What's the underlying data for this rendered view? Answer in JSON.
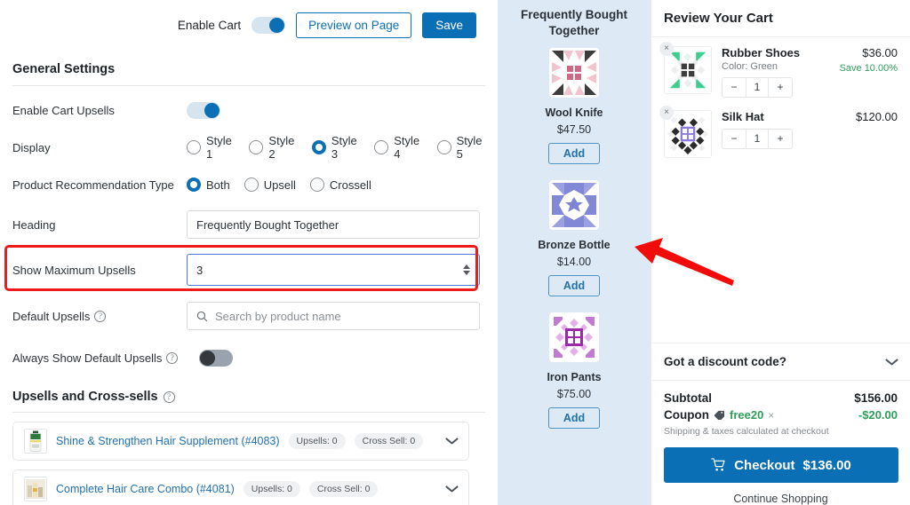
{
  "settings": {
    "topbar": {
      "enable_cart_label": "Enable Cart",
      "enable_cart_state": "on",
      "preview_label": "Preview on Page",
      "save_label": "Save"
    },
    "section_title": "General Settings",
    "enable_upsells": {
      "label": "Enable Cart Upsells",
      "state": "on"
    },
    "display": {
      "label": "Display",
      "options": [
        "Style 1",
        "Style 2",
        "Style 3",
        "Style 4",
        "Style 5"
      ],
      "selected": "Style 3"
    },
    "recommendation_type": {
      "label": "Product Recommendation Type",
      "options": [
        "Both",
        "Upsell",
        "Crossell"
      ],
      "selected": "Both"
    },
    "heading": {
      "label": "Heading",
      "value": "Frequently Bought Together"
    },
    "max_upsells": {
      "label": "Show Maximum Upsells",
      "value": "3",
      "highlighted": true
    },
    "default_upsells": {
      "label": "Default Upsells",
      "help": "?",
      "placeholder": "Search by product name",
      "value": ""
    },
    "always_show_default": {
      "label": "Always Show Default Upsells",
      "help": "?",
      "state": "off"
    },
    "upsells_cross_sells": {
      "title": "Upsells and Cross-sells",
      "help": "?",
      "products": [
        {
          "name": "Shine & Strengthen Hair Supplement (#4083)",
          "upsells_badge": "Upsells: 0",
          "crosssell_badge": "Cross Sell: 0"
        },
        {
          "name": "Complete Hair Care Combo (#4081)",
          "upsells_badge": "Upsells: 0",
          "crosssell_badge": "Cross Sell: 0"
        }
      ]
    }
  },
  "fbt": {
    "title": "Frequently Bought\nTogether",
    "title_line1": "Frequently Bought",
    "title_line2": "Together",
    "items": [
      {
        "name": "Wool Knife",
        "price": "$47.50",
        "add_label": "Add",
        "swatch": "#d9788f"
      },
      {
        "name": "Bronze Bottle",
        "price": "$14.00",
        "add_label": "Add",
        "swatch": "#7b7fd0"
      },
      {
        "name": "Iron Pants",
        "price": "$75.00",
        "add_label": "Add",
        "swatch": "#9b29a8"
      }
    ]
  },
  "cart": {
    "title": "Review Your Cart",
    "items": [
      {
        "name": "Rubber Shoes",
        "variant": "Color: Green",
        "price": "$36.00",
        "save": "Save 10.00%",
        "qty": "1",
        "minus": "−",
        "plus": "+",
        "remove": "×",
        "swatch": "#3ecf8e"
      },
      {
        "name": "Silk Hat",
        "variant": "",
        "price": "$120.00",
        "save": "",
        "qty": "1",
        "minus": "−",
        "plus": "+",
        "remove": "×",
        "swatch": "#8b7ae0"
      }
    ],
    "discount": {
      "label": "Got a discount code?"
    },
    "totals": {
      "subtotal_label": "Subtotal",
      "subtotal_value": "$156.00",
      "coupon_label": "Coupon",
      "coupon_code": "free20",
      "coupon_remove": "×",
      "coupon_value": "-$20.00",
      "shipping_note": "Shipping & taxes calculated at checkout"
    },
    "checkout_label": "Checkout",
    "checkout_total": "$136.00",
    "continue_label": "Continue Shopping"
  },
  "colors": {
    "accent_blue": "#0b6fb5",
    "link_blue": "#2271b1",
    "green": "#2e9e5b",
    "highlight_red": "#ee1b1b",
    "fbt_bg": "#dde9f4"
  }
}
